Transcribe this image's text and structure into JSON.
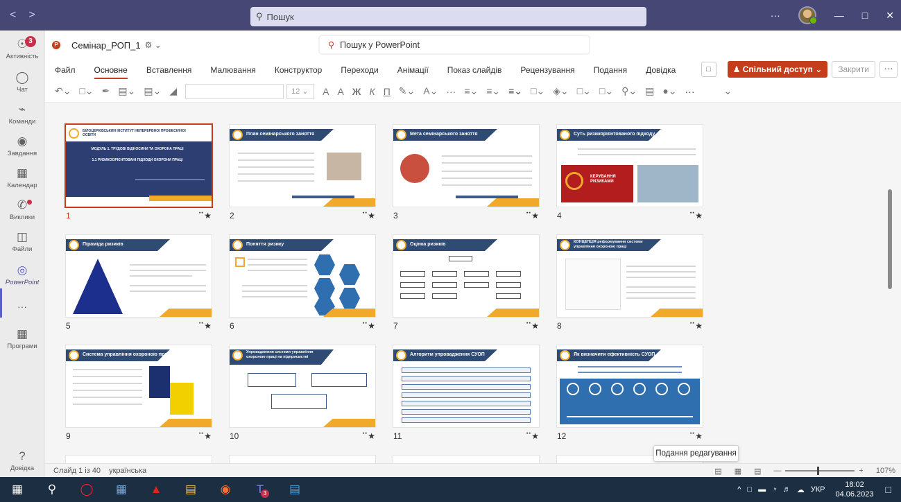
{
  "teams": {
    "search_placeholder": "Пошук",
    "sidebar": [
      {
        "label": "Активність",
        "badge": "3"
      },
      {
        "label": "Чат"
      },
      {
        "label": "Команди"
      },
      {
        "label": "Завдання"
      },
      {
        "label": "Календар"
      },
      {
        "label": "Виклики"
      },
      {
        "label": "Файли"
      },
      {
        "label": "PowerPoint"
      },
      {
        "label": "Програми"
      },
      {
        "label": "Довідка"
      }
    ]
  },
  "ppt": {
    "doc_name": "Семінар_РОП_1",
    "search_placeholder": "Пошук у PowerPoint",
    "menu": [
      "Файл",
      "Основне",
      "Вставлення",
      "Малювання",
      "Конструктор",
      "Переходи",
      "Анімації",
      "Показ слайдів",
      "Рецензування",
      "Подання",
      "Довідка"
    ],
    "active_menu": "Основне",
    "share_label": "Спільний доступ",
    "close_label": "Закрити",
    "font_size": "12"
  },
  "slides": [
    {
      "num": "1",
      "title": "БІЛОЦЕРКІВСЬКИЙ ІНСТИТУТ НЕПЕРЕРВНОЇ ПРОФЕСІЙНОЇ ОСВІТИ"
    },
    {
      "num": "2",
      "title": "План семінарського заняття"
    },
    {
      "num": "3",
      "title": "Мета семінарського заняття"
    },
    {
      "num": "4",
      "title": "Суть ризикорієнтованого підходу"
    },
    {
      "num": "5",
      "title": "Піраміда ризиків"
    },
    {
      "num": "6",
      "title": "Поняття ризику"
    },
    {
      "num": "7",
      "title": "Оцінка ризиків"
    },
    {
      "num": "8",
      "title": "КОНЦЕПЦІЯ реформування системи управління охороною праці"
    },
    {
      "num": "9",
      "title": "Система управління охороною праці"
    },
    {
      "num": "10",
      "title": "Упровадження системи управління охороною праці на підприємстві"
    },
    {
      "num": "11",
      "title": "Алгоритм упровадження СУОП"
    },
    {
      "num": "12",
      "title": "Як визначити ефективність СУОП"
    }
  ],
  "slide4_banner": "КЕРУВАННЯ РИЗИКАМИ",
  "status": {
    "slide_info": "Слайд 1 із 40",
    "language": "українська",
    "zoom": "107%",
    "tooltip": "Подання редагування"
  },
  "taskbar": {
    "lang": "УКР",
    "time": "18:02",
    "date": "04.06.2023",
    "teams_badge": "3"
  },
  "colors": {
    "teams_bar": "#464775",
    "ppt_accent": "#c43e1c",
    "slide_navy": "#2f4a73",
    "slide_orange": "#f0a92a"
  }
}
